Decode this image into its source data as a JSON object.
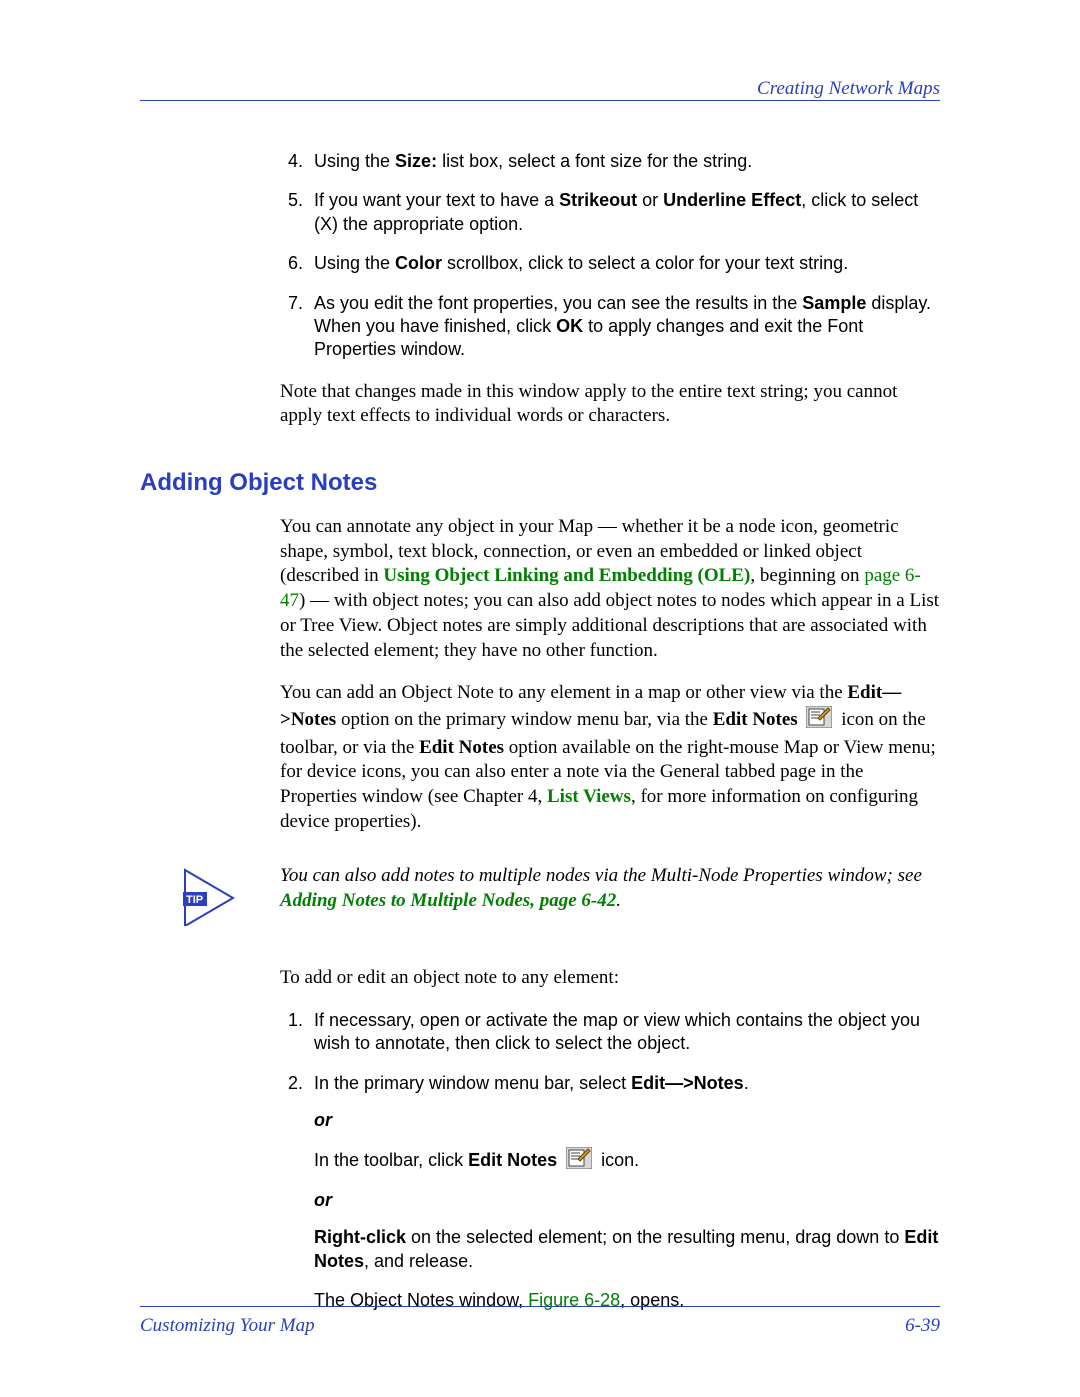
{
  "header": {
    "chapter_title": "Creating Network Maps"
  },
  "intro_steps": {
    "s4_a": "Using the ",
    "s4_b": "Size:",
    "s4_c": " list box, select a font size for the string.",
    "s5_a": "If you want your text to have a ",
    "s5_b": "Strikeout",
    "s5_c": " or ",
    "s5_d": "Underline Effect",
    "s5_e": ", click to select (X) the appropriate option.",
    "s6_a": "Using the ",
    "s6_b": "Color",
    "s6_c": " scrollbox, click to select a color for your text string.",
    "s7_a": "As you edit the font properties, you can see the results in the ",
    "s7_b": "Sample",
    "s7_c": " display. When you have finished, click ",
    "s7_d": "OK",
    "s7_e": " to apply changes and exit the Font Properties window."
  },
  "note_para": "Note that changes made in this window apply to the entire text string; you cannot apply text effects to individual words or characters.",
  "section_heading": "Adding Object Notes",
  "para1": {
    "a": "You can annotate any object in your Map — whether it be a node icon, geometric shape, symbol, text block, connection, or even an embedded or linked object (described in ",
    "link1": "Using Object Linking and Embedding (OLE)",
    "b": ", beginning on ",
    "pageref1": "page 6-47",
    "c": ") — with object notes; you can also add object notes to nodes which appear in a List or Tree View. Object notes are simply additional descriptions that are associated with the selected element; they have no other function."
  },
  "para2": {
    "a": "You can add an Object Note to any element in a map or other view via the ",
    "b": "Edit—>Notes",
    "c": " option on the primary window menu bar, via the ",
    "d": "Edit Notes",
    "e": " icon on the toolbar, or via the ",
    "f": "Edit Notes",
    "g": " option available on the right-mouse Map or View menu; for device icons, you can also enter a note via the General tabbed page in the Properties window (see Chapter 4, ",
    "link2": "List Views",
    "h": ", for more information on configuring device properties)."
  },
  "tip": {
    "label": "TIP",
    "text_a": "You can also add notes to multiple nodes via the Multi-Node Properties window; see ",
    "link": "Adding Notes to Multiple Nodes",
    "text_b": ", ",
    "pageref": "page 6-42",
    "text_c": "."
  },
  "para3": "To add or edit an object note to any element:",
  "steps2": {
    "s1": "If necessary, open or activate the map or view which contains the object you wish to annotate, then click to select the object.",
    "s2_a": "In the primary window menu bar, select ",
    "s2_b": "Edit—>Notes",
    "s2_c": ".",
    "or": "or",
    "s2_alt1_a": "In the toolbar, click ",
    "s2_alt1_b": "Edit Notes",
    "s2_alt1_c": " icon.",
    "s2_alt2_a": "Right-click",
    "s2_alt2_b": " on the selected element; on the resulting menu, drag down to ",
    "s2_alt2_c": "Edit Notes",
    "s2_alt2_d": ", and release.",
    "s2_result_a": "The Object Notes window, ",
    "s2_result_link": "Figure 6-28",
    "s2_result_b": ", opens."
  },
  "footer": {
    "left": "Customizing Your Map",
    "right": "6-39"
  }
}
